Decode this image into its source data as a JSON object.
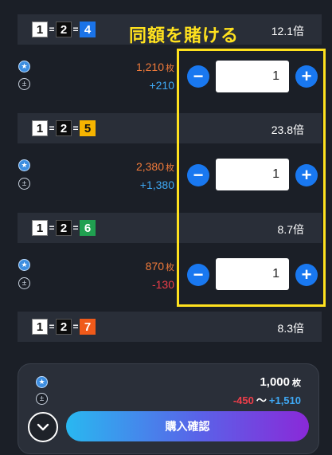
{
  "annotation": {
    "text": "同額を賭ける",
    "color": "#ffe11e"
  },
  "combos": [
    {
      "first": "1",
      "second": "2",
      "third": "4",
      "third_color": "#1a73e8",
      "odds": "12.1倍",
      "coins": "1,210",
      "coin_unit": "枚",
      "gain": "+210",
      "quantity": "1"
    },
    {
      "first": "1",
      "second": "2",
      "third": "5",
      "third_color": "#f6b400",
      "odds": "23.8倍",
      "coins": "2,380",
      "coin_unit": "枚",
      "gain": "+1,380",
      "quantity": "1"
    },
    {
      "first": "1",
      "second": "2",
      "third": "6",
      "third_color": "#20a050",
      "odds": "8.7倍",
      "coins": "870",
      "coin_unit": "枚",
      "gain": "-130",
      "quantity": "1"
    },
    {
      "first": "1",
      "second": "2",
      "third": "7",
      "third_color": "#f05a1a",
      "odds": "8.3倍"
    }
  ],
  "equals": "=",
  "minus_glyph": "−",
  "plus_glyph": "+",
  "summary": {
    "total": "1,000",
    "total_unit": "枚",
    "range_low": "-450",
    "range_sep": "〜",
    "range_high": "+1,510",
    "purchase_label": "購入確認"
  },
  "icons": {
    "star": "star-circle-icon",
    "plusminus": "plus-minus-circle-icon",
    "collapse": "chevron-down-icon"
  }
}
